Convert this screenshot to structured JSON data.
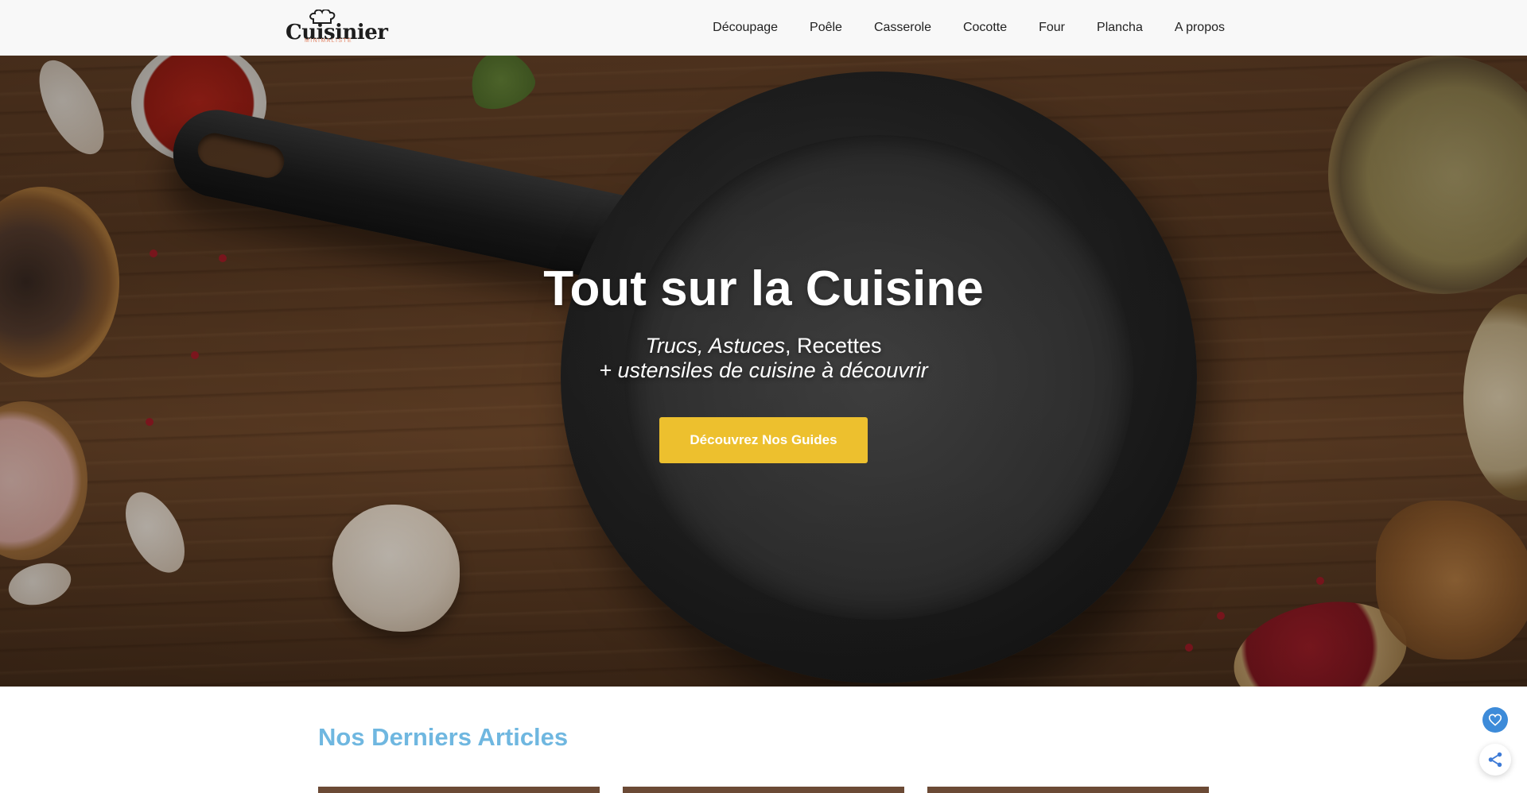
{
  "header": {
    "logo": {
      "wordmark": "Cuisinier",
      "tagline": "MINIMALISTE"
    },
    "nav": [
      {
        "label": "Découpage"
      },
      {
        "label": "Poêle"
      },
      {
        "label": "Casserole"
      },
      {
        "label": "Cocotte"
      },
      {
        "label": "Four"
      },
      {
        "label": "Plancha"
      },
      {
        "label": "A propos"
      }
    ]
  },
  "hero": {
    "title": "Tout sur la Cuisine",
    "subtitle_italic_1": "Trucs, Astuces",
    "subtitle_sep": ", Recettes",
    "subtitle_line2": "+ ustensiles de cuisine à découvrir",
    "cta_label": "Découvrez Nos Guides",
    "cta_color": "#edc02e"
  },
  "articles": {
    "title": "Nos Derniers Articles",
    "title_color": "#6fb7e0"
  },
  "floating": {
    "like_icon": "heart-icon",
    "share_icon": "share-icon",
    "like_color": "#3d8bd9"
  }
}
